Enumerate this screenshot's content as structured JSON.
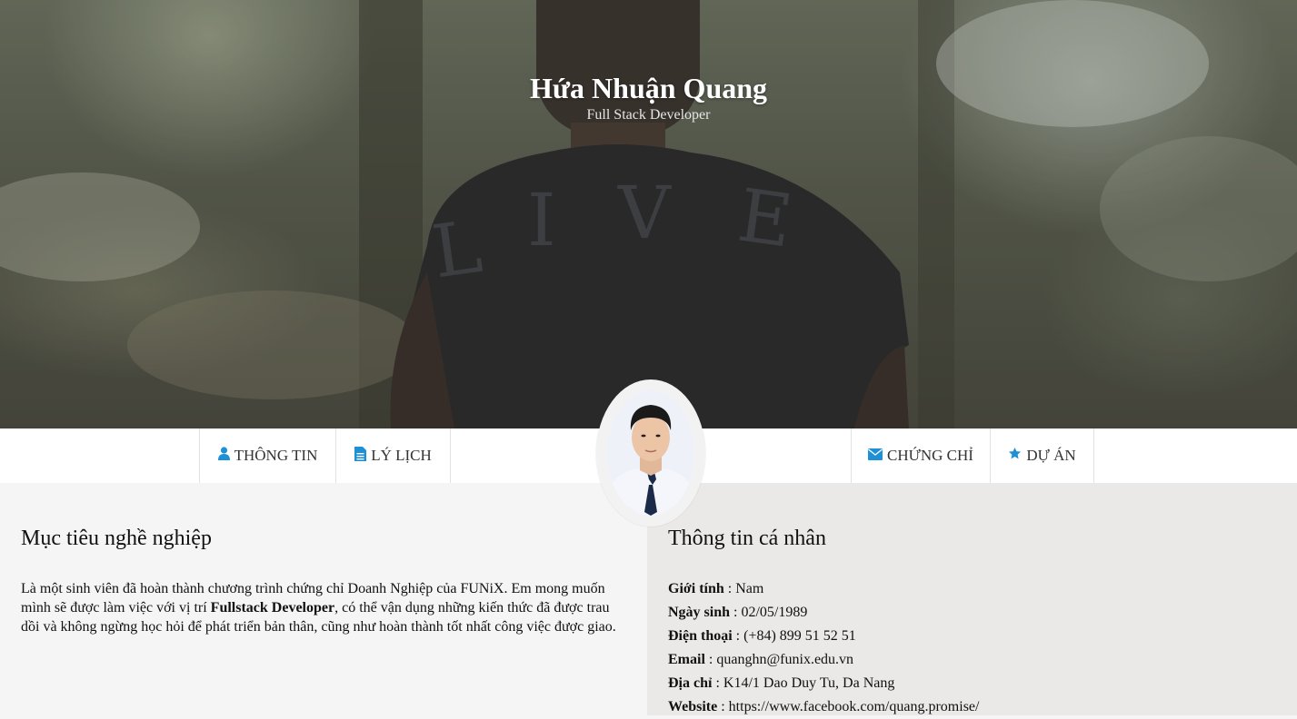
{
  "hero": {
    "name": "Hứa Nhuận Quang",
    "role": "Full Stack Developer"
  },
  "nav": {
    "items": [
      {
        "label": "THÔNG TIN",
        "icon": "user-icon"
      },
      {
        "label": "LÝ LỊCH",
        "icon": "file-text-icon"
      },
      {
        "label": "CHỨNG CHỈ",
        "icon": "envelope-icon"
      },
      {
        "label": "DỰ ÁN",
        "icon": "star-icon"
      }
    ],
    "icon_color": "#1e90d6"
  },
  "objective": {
    "title": "Mục tiêu nghề nghiệp",
    "text_before": "Là một sinh viên đã hoàn thành chương trình chứng chỉ Doanh Nghiệp của FUNiX. Em mong muốn mình sẽ được làm việc với vị trí ",
    "highlight": "Fullstack Developer",
    "text_after": ", có thể vận dụng những kiến thức đã được trau dồi và không ngừng học hỏi để phát triển bản thân, cũng như hoàn thành tốt nhất công việc được giao."
  },
  "personal": {
    "title": "Thông tin cá nhân",
    "fields": [
      {
        "label": "Giới tính",
        "value": "Nam"
      },
      {
        "label": "Ngày sinh",
        "value": "02/05/1989"
      },
      {
        "label": "Điện thoại",
        "value": "(+84) 899 51 52 51"
      },
      {
        "label": "Email",
        "value": "quanghn@funix.edu.vn"
      },
      {
        "label": "Địa chỉ",
        "value": "K14/1 Dao Duy Tu, Da Nang"
      },
      {
        "label": "Website",
        "value": "https://www.facebook.com/quang.promise/"
      }
    ]
  }
}
